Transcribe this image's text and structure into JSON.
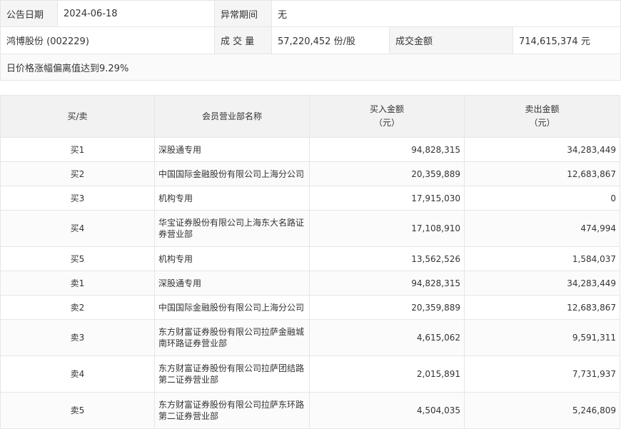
{
  "info": {
    "announce_label": "公告日期",
    "announce_value": "2024-06-18",
    "abnormal_label": "异常期间",
    "abnormal_value": "无",
    "stock_name": "鸿博股份 (002229)",
    "volume_label": "成 交 量",
    "volume_value": "57,220,452 份/股",
    "amount_label": "成交金额",
    "amount_value": "714,615,374 元",
    "reason": "日价格涨幅偏离值达到9.29%"
  },
  "table": {
    "headers": {
      "side": "买/卖",
      "dept": "会员营业部名称",
      "buy_line1": "买入金额",
      "buy_line2": "（元）",
      "sell_line1": "卖出金额",
      "sell_line2": "（元）"
    },
    "rows": [
      {
        "side": "买1",
        "dept": "深股通专用",
        "buy": "94,828,315",
        "sell": "34,283,449"
      },
      {
        "side": "买2",
        "dept": "中国国际金融股份有限公司上海分公司",
        "buy": "20,359,889",
        "sell": "12,683,867"
      },
      {
        "side": "买3",
        "dept": "机构专用",
        "buy": "17,915,030",
        "sell": "0"
      },
      {
        "side": "买4",
        "dept": "华宝证券股份有限公司上海东大名路证券营业部",
        "buy": "17,108,910",
        "sell": "474,994"
      },
      {
        "side": "买5",
        "dept": "机构专用",
        "buy": "13,562,526",
        "sell": "1,584,037"
      },
      {
        "side": "卖1",
        "dept": "深股通专用",
        "buy": "94,828,315",
        "sell": "34,283,449"
      },
      {
        "side": "卖2",
        "dept": "中国国际金融股份有限公司上海分公司",
        "buy": "20,359,889",
        "sell": "12,683,867"
      },
      {
        "side": "卖3",
        "dept": "东方财富证券股份有限公司拉萨金融城南环路证券营业部",
        "buy": "4,615,062",
        "sell": "9,591,311"
      },
      {
        "side": "卖4",
        "dept": "东方财富证券股份有限公司拉萨团结路第二证券营业部",
        "buy": "2,015,891",
        "sell": "7,731,937"
      },
      {
        "side": "卖5",
        "dept": "东方财富证券股份有限公司拉萨东环路第二证券营业部",
        "buy": "4,504,035",
        "sell": "5,246,809"
      }
    ]
  }
}
